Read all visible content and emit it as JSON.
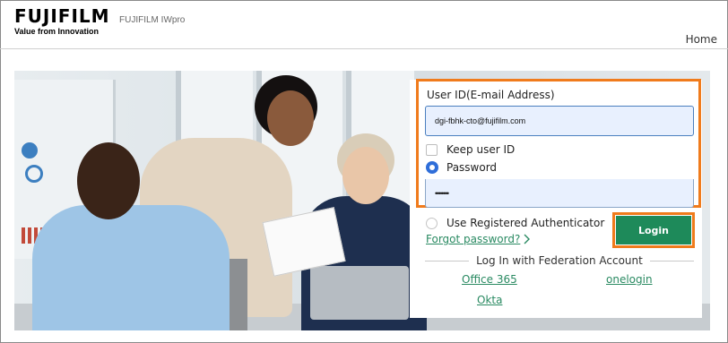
{
  "header": {
    "logo_text": "FUJIFILM",
    "logo_tagline": "Value from Innovation",
    "app_name": "FUJIFILM IWpro",
    "home_link": "Home"
  },
  "login": {
    "user_id_label": "User ID(E-mail Address)",
    "user_id_value": "dgi-fbhk-cto@fujifilm.com",
    "keep_user_id_label": "Keep user ID",
    "keep_user_id_checked": false,
    "password_option_label": "Password",
    "password_value": "•••••••",
    "authenticator_option_label": "Use Registered Authenticator",
    "login_button": "Login",
    "forgot_password": "Forgot password?",
    "federation_heading": "Log In with Federation Account",
    "federation_links": [
      "Office 365",
      "onelogin",
      "Okta"
    ]
  },
  "colors": {
    "accent_green": "#1e8a5a",
    "link_green": "#2a8a62",
    "highlight_orange": "#f07b1c",
    "radio_blue": "#2f6ed9",
    "input_bg": "#e8f0fe",
    "brand_red": "#e60012"
  },
  "icons": {
    "forgot_arrow": "chevron-right-icon"
  }
}
